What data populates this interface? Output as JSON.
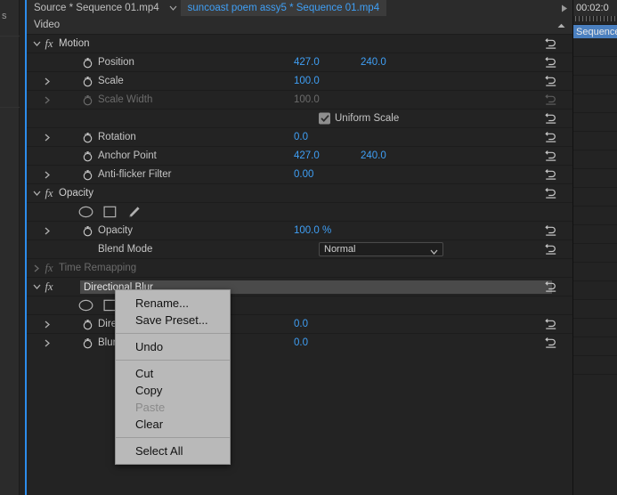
{
  "app": {
    "accent_blue": "#3f9ff5",
    "selection_blue": "#4a7fbf",
    "panel_bg": "#232323",
    "menu_bg": "#b9b9b9"
  },
  "left_sliver": {
    "stub_text": "s"
  },
  "tabs": {
    "source_tab": "Source * Sequence 01.mp4",
    "active_tab": "suncoast poem assy5 * Sequence 01.mp4",
    "caret_icon": "chevron-down-icon",
    "play_icon": "play-triangle-icon"
  },
  "video_header": {
    "label": "Video",
    "collapse_icon": "triangle-up-icon"
  },
  "rows": [
    {
      "id": "motion",
      "kind": "effect",
      "arrow": "chevron-down-icon",
      "fx": "fx",
      "name": "Motion",
      "reset": "reset-icon",
      "dim": false
    },
    {
      "id": "position",
      "kind": "property",
      "arrow": "",
      "stopwatch": "stopwatch-icon",
      "name": "Position",
      "value": "427.0",
      "value2": "240.0",
      "reset": "reset-icon",
      "dim": false
    },
    {
      "id": "scale",
      "kind": "property",
      "arrow": "chevron-right-icon",
      "stopwatch": "stopwatch-icon",
      "name": "Scale",
      "value": "100.0",
      "value2": "",
      "reset": "reset-icon",
      "dim": false
    },
    {
      "id": "scale-width",
      "kind": "property",
      "arrow": "chevron-right-icon",
      "stopwatch": "stopwatch-icon",
      "name": "Scale Width",
      "value": "100.0",
      "value2": "",
      "reset": "reset-icon",
      "dim": true
    },
    {
      "id": "uniform-scale",
      "kind": "checkbox",
      "checkbox_checked": true,
      "checkbox_label": "Uniform Scale",
      "reset": "reset-icon",
      "dim": false
    },
    {
      "id": "rotation",
      "kind": "property",
      "arrow": "chevron-right-icon",
      "stopwatch": "stopwatch-icon",
      "name": "Rotation",
      "value": "0.0",
      "value2": "",
      "reset": "reset-icon",
      "dim": false
    },
    {
      "id": "anchor-point",
      "kind": "property",
      "arrow": "",
      "stopwatch": "stopwatch-icon",
      "name": "Anchor Point",
      "value": "427.0",
      "value2": "240.0",
      "reset": "reset-icon",
      "dim": false
    },
    {
      "id": "anti-flicker-filter",
      "kind": "property",
      "arrow": "chevron-right-icon",
      "stopwatch": "stopwatch-icon",
      "name": "Anti-flicker Filter",
      "value": "0.00",
      "value2": "",
      "reset": "reset-icon",
      "dim": false
    },
    {
      "id": "opacity-effect",
      "kind": "effect",
      "arrow": "chevron-down-icon",
      "fx": "fx",
      "name": "Opacity",
      "reset": "reset-icon",
      "dim": false
    },
    {
      "id": "opacity-mask-tools",
      "kind": "masktools",
      "tools": [
        "ellipse-mask-icon",
        "rectangle-mask-icon",
        "pen-mask-icon"
      ],
      "reset": "",
      "dim": false
    },
    {
      "id": "opacity",
      "kind": "property",
      "arrow": "chevron-right-icon",
      "stopwatch": "stopwatch-icon",
      "name": "Opacity",
      "value": "100.0 %",
      "value2": "",
      "reset": "reset-icon",
      "dim": false
    },
    {
      "id": "blend-mode",
      "kind": "dropdown",
      "name": "Blend Mode",
      "selected": "Normal",
      "caret_icon": "chevron-down-icon",
      "reset": "reset-icon",
      "dim": false
    },
    {
      "id": "time-remapping",
      "kind": "effect",
      "arrow": "chevron-right-icon",
      "fx": "fx",
      "name": "Time Remapping",
      "reset": "",
      "dim": true
    },
    {
      "id": "directional-blur",
      "kind": "effect-rename",
      "arrow": "chevron-down-icon",
      "fx": "fx",
      "name": "Directional Blur",
      "reset": "reset-icon",
      "dim": false
    },
    {
      "id": "blur-mask-tools",
      "kind": "masktools",
      "tools": [
        "ellipse-mask-icon",
        "rectangle-mask-icon",
        "pen-mask-icon"
      ],
      "reset": "",
      "dim": false
    },
    {
      "id": "direction",
      "kind": "property",
      "arrow": "chevron-right-icon",
      "stopwatch": "stopwatch-icon",
      "name": "Direction",
      "value": "0.0",
      "value2": "",
      "reset": "reset-icon",
      "dim": false
    },
    {
      "id": "blur-length",
      "kind": "property",
      "arrow": "chevron-right-icon",
      "stopwatch": "stopwatch-icon",
      "name": "Blur Length",
      "value": "0.0",
      "value2": "",
      "reset": "reset-icon",
      "dim": false
    }
  ],
  "context_menu": {
    "items": [
      {
        "label": "Rename...",
        "disabled": false,
        "separator_after": false
      },
      {
        "label": "Save Preset...",
        "disabled": false,
        "separator_after": true
      },
      {
        "label": "Undo",
        "disabled": false,
        "separator_after": true
      },
      {
        "label": "Cut",
        "disabled": false,
        "separator_after": false
      },
      {
        "label": "Copy",
        "disabled": false,
        "separator_after": false
      },
      {
        "label": "Paste",
        "disabled": true,
        "separator_after": false
      },
      {
        "label": "Clear",
        "disabled": false,
        "separator_after": true
      },
      {
        "label": "Select All",
        "disabled": false,
        "separator_after": false
      }
    ]
  },
  "right_column": {
    "timecode": "00:02:0",
    "sequence_chip": "Sequence"
  }
}
